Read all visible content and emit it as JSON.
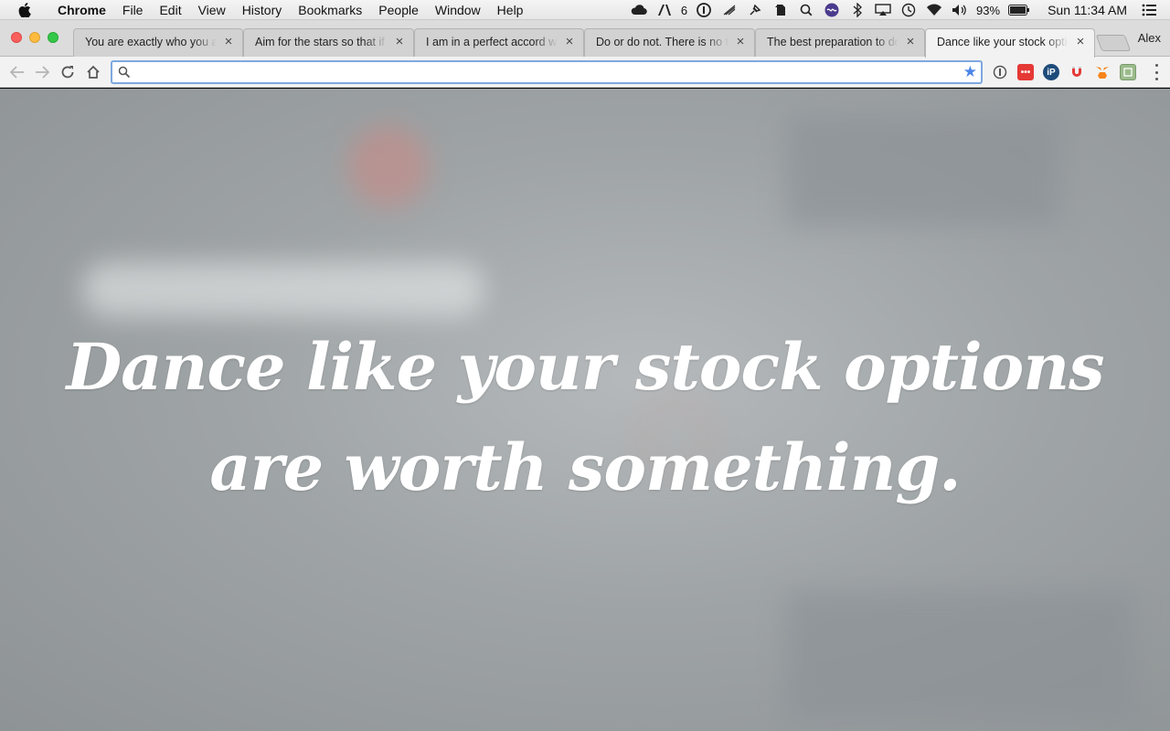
{
  "menubar": {
    "app_name": "Chrome",
    "items": [
      "File",
      "Edit",
      "View",
      "History",
      "Bookmarks",
      "People",
      "Window",
      "Help"
    ],
    "status": {
      "adobe_count": "6",
      "battery": "93%",
      "clock": "Sun 11:34 AM"
    }
  },
  "tabs": [
    {
      "title": "You are exactly who you are",
      "active": false
    },
    {
      "title": "Aim for the stars so that if",
      "active": false
    },
    {
      "title": "I am in a perfect accord with",
      "active": false
    },
    {
      "title": "Do or do not. There is no try",
      "active": false
    },
    {
      "title": "The best preparation to do",
      "active": false
    },
    {
      "title": "Dance like your stock options",
      "active": true
    }
  ],
  "profile_name": "Alex",
  "omnibox": {
    "value": "",
    "placeholder": ""
  },
  "page": {
    "quote_line1": "Dance like your stock options",
    "quote_line2": "are worth something."
  },
  "colors": {
    "accent": "#4a86e8",
    "omnibox_border": "#7ea8e0",
    "page_overlay": "#9fa4a6"
  }
}
